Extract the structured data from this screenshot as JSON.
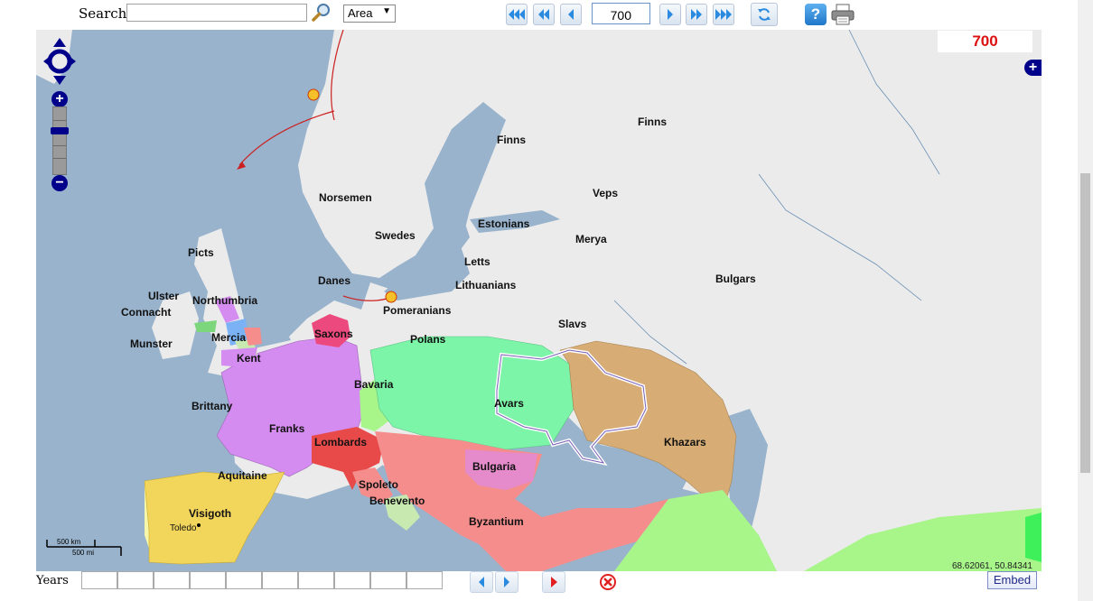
{
  "toolbar": {
    "search_label": "Search",
    "search_value": "",
    "mode_selected": "Area",
    "year_value": "700",
    "icons": [
      "search-icon",
      "first-icon",
      "back-fast-icon",
      "back-icon",
      "forward-icon",
      "forward-fast-icon",
      "last-icon",
      "refresh-icon",
      "help-icon",
      "print-icon"
    ]
  },
  "map": {
    "year_display": "700",
    "coordinates": "68.62061, 50.84341",
    "scale": {
      "km": "500 km",
      "mi": "500 mi"
    },
    "labels": {
      "finns_n": "Finns",
      "finns_c": "Finns",
      "veps": "Veps",
      "merya": "Merya",
      "norsemen": "Norsemen",
      "estonians": "Estonians",
      "swedes": "Swedes",
      "letts": "Letts",
      "lithuanians": "Lithuanians",
      "bulgars": "Bulgars",
      "picts": "Picts",
      "danes": "Danes",
      "ulster": "Ulster",
      "northumbria": "Northumbria",
      "connacht": "Connacht",
      "pomeranians": "Pomeranians",
      "slavs": "Slavs",
      "munster": "Munster",
      "mercia": "Mercia",
      "saxons": "Saxons",
      "polans": "Polans",
      "kent": "Kent",
      "bavaria": "Bavaria",
      "brittany": "Brittany",
      "avars": "Avars",
      "franks": "Franks",
      "khazars": "Khazars",
      "lombards": "Lombards",
      "bulgaria": "Bulgaria",
      "aquitaine": "Aquitaine",
      "spoleto": "Spoleto",
      "benevento": "Benevento",
      "visigoth": "Visigoth",
      "toledo": "Toledo",
      "byzantium": "Byzantium"
    },
    "colors": {
      "sea": "#99b3cc",
      "land": "#ebebeb",
      "franks": "#d58cf0",
      "avars": "#7cf5a8",
      "khazars": "#d7ad75",
      "byzantium": "#f58d8d",
      "visigoth": "#f2d55b",
      "lombards": "#e84a4a",
      "bulgaria": "#e58bcc",
      "arabs": "#a8f58a"
    }
  },
  "bottom": {
    "years_label": "Years",
    "embed_label": "Embed"
  }
}
